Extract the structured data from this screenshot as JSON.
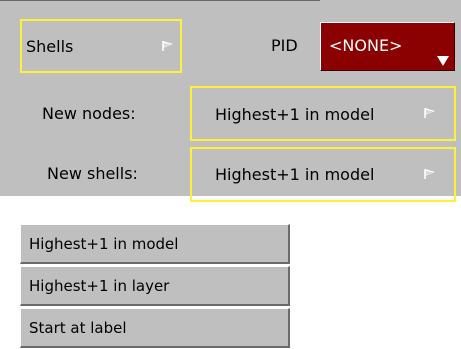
{
  "panel": {
    "element_type_label": "Shells",
    "pid_label": "PID",
    "pid_value": "<NONE>",
    "new_nodes_label": "New nodes:",
    "new_nodes_value": "Highest+1 in model",
    "new_shells_label": "New shells:",
    "new_shells_value": "Highest+1 in model"
  },
  "menu": {
    "items": [
      {
        "label": "Highest+1 in model"
      },
      {
        "label": "Highest+1 in layer"
      },
      {
        "label": "Start at label"
      }
    ]
  },
  "colors": {
    "panel_bg": "#bfbfbf",
    "highlight_border": "#fff03c",
    "pid_bg": "#8b0000",
    "pid_text": "#ffffff"
  },
  "icons": {
    "popup": "flag-icon",
    "pid_dropdown": "triangle-down-icon"
  }
}
